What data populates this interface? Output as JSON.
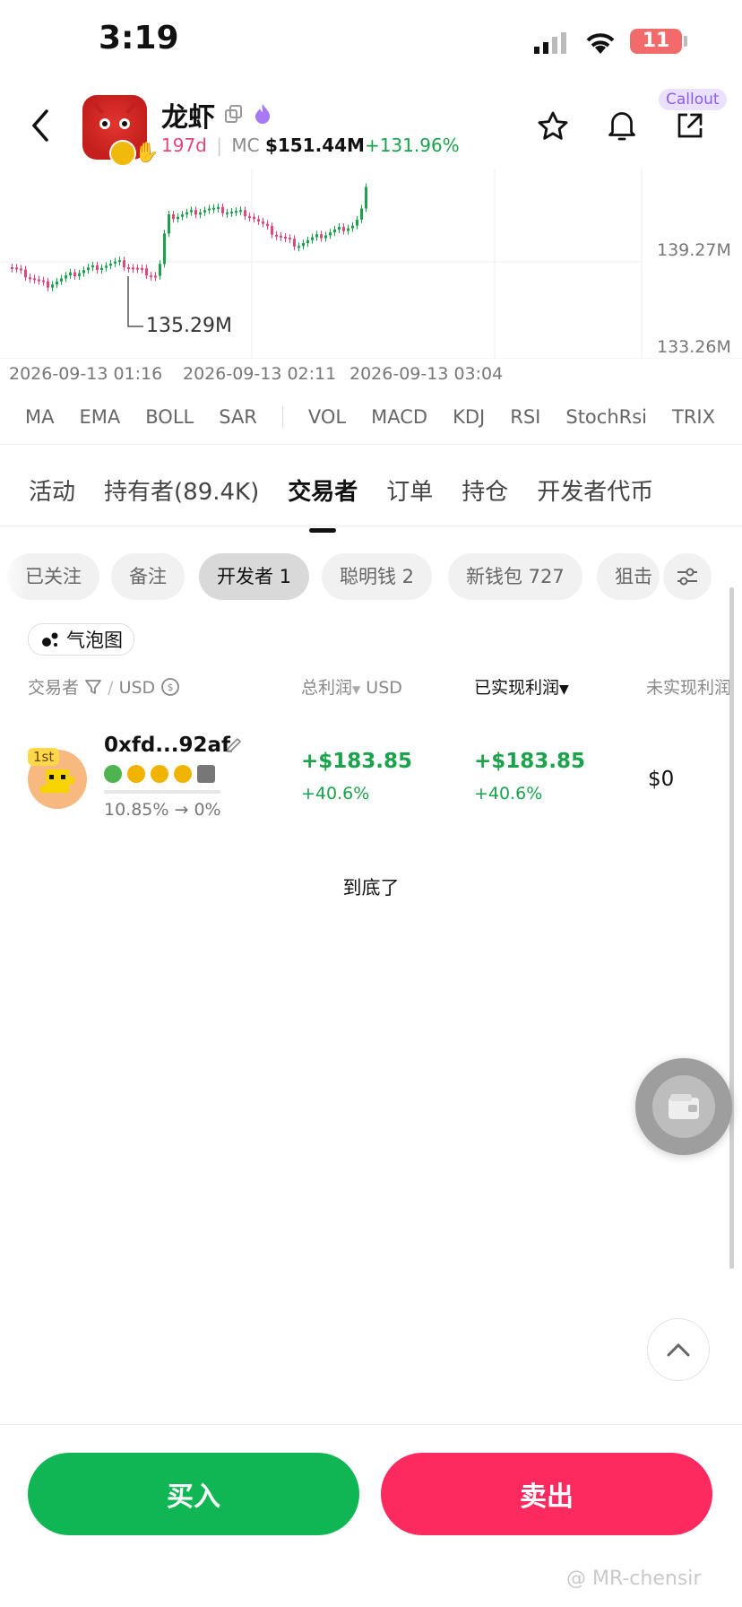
{
  "status_bar": {
    "time": "3:19",
    "battery": "11"
  },
  "token": {
    "name": "龙虾",
    "age": "197d",
    "mc_label": "MC",
    "market_cap": "$151.44M",
    "change": "+131.96%",
    "callout_label": "Callout"
  },
  "chart": {
    "price_high": "139.27M",
    "price_low": "133.26M",
    "marker": "135.29M",
    "times": [
      "2026-09-13 01:16",
      "2026-09-13 02:11",
      "2026-09-13 03:04"
    ]
  },
  "chart_data": {
    "type": "candlestick",
    "y_ticks": [
      "139.27M",
      "133.26M"
    ],
    "x_ticks": [
      "2026-09-13 01:16",
      "2026-09-13 02:11",
      "2026-09-13 03:04"
    ],
    "annotations": [
      "135.29M"
    ]
  },
  "indicators": {
    "overlay": [
      "MA",
      "EMA",
      "BOLL",
      "SAR"
    ],
    "oscillators": [
      "VOL",
      "MACD",
      "KDJ",
      "RSI",
      "StochRsi",
      "TRIX"
    ]
  },
  "tabs": [
    {
      "label": "活动"
    },
    {
      "label": "持有者(89.4K)"
    },
    {
      "label": "交易者",
      "active": true
    },
    {
      "label": "订单"
    },
    {
      "label": "持仓"
    },
    {
      "label": "开发者代币"
    }
  ],
  "filters": [
    {
      "label": "已关注"
    },
    {
      "label": "备注"
    },
    {
      "label": "开发者 1",
      "active": true
    },
    {
      "label": "聪明钱 2"
    },
    {
      "label": "新钱包 727"
    },
    {
      "label": "狙击"
    }
  ],
  "bubble_label": "气泡图",
  "table": {
    "headers": {
      "trader": "交易者",
      "unit": "USD",
      "total_profit": "总利润",
      "total_unit": "USD",
      "realized": "已实现利润",
      "unrealized": "未实现利润"
    },
    "rows": [
      {
        "rank": "1st",
        "address": "0xfd...92af",
        "holding": "10.85% → 0%",
        "total_profit": "+$183.85",
        "total_pct": "+40.6%",
        "realized": "+$183.85",
        "realized_pct": "+40.6%",
        "unrealized": "$0"
      }
    ],
    "end_text": "到底了"
  },
  "actions": {
    "buy": "买入",
    "sell": "卖出"
  },
  "watermark": "@ MR-chensir",
  "colors": {
    "buy": "#0fb653",
    "sell": "#fd2a5f",
    "profit": "#1aa34a",
    "age": "#e2457a",
    "callout": "#8d5cf0"
  }
}
